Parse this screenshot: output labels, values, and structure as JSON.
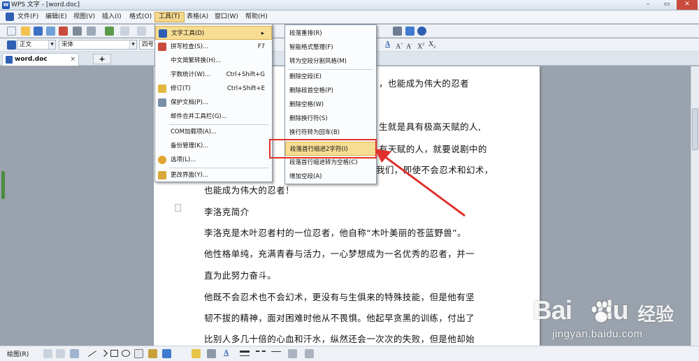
{
  "window": {
    "title": "WPS 文字 - [word.doc]",
    "app_icon_text": "W"
  },
  "menubar": {
    "items": [
      "文件(F)",
      "编辑(E)",
      "视图(V)",
      "插入(I)",
      "格式(O)",
      "工具(T)",
      "表格(A)",
      "窗口(W)",
      "帮助(H)"
    ],
    "active_index": 5
  },
  "formatting": {
    "style_value": "正文",
    "font_value": "宋体",
    "size_value": "四号"
  },
  "tabs": {
    "doc_label": "word.doc",
    "close_glyph": "×",
    "add_glyph": "+"
  },
  "tools_menu": {
    "items": [
      {
        "label": "文字工具(D)",
        "shortcut": "",
        "icon": "text-tool-icon",
        "submenu": true
      },
      {
        "label": "拼写检查(S)...",
        "shortcut": "F7",
        "icon": "spellcheck-icon"
      },
      {
        "label": "中文简繁转换(H)...",
        "shortcut": "",
        "icon": ""
      },
      {
        "label": "字数统计(W)...",
        "shortcut": "Ctrl+Shift+G",
        "icon": ""
      },
      {
        "label": "修订(T)",
        "shortcut": "Ctrl+Shift+E",
        "icon": "revision-icon"
      },
      {
        "label": "保护文档(P)...",
        "shortcut": "",
        "icon": "protect-icon"
      },
      {
        "label": "邮件合并工具栏(G)...",
        "shortcut": "",
        "icon": ""
      },
      {
        "label": "COM加载项(A)...",
        "shortcut": "",
        "icon": ""
      },
      {
        "label": "备份管理(K)...",
        "shortcut": "",
        "icon": ""
      },
      {
        "label": "选项(L)...",
        "shortcut": "",
        "icon": "gear-icon"
      },
      {
        "label": "更改界面(Y)...",
        "shortcut": "",
        "icon": "interface-icon"
      }
    ]
  },
  "text_tools_submenu": {
    "items": [
      "段落重排(R)",
      "智能格式整理(F)",
      "转为空段分割风格(M)",
      "删除空段(E)",
      "删除段首空格(P)",
      "删除空格(W)",
      "删除换行符(S)",
      "换行符转为回车(B)",
      "段落首行缩进2字符(I)",
      "段落首行缩进转为空格(C)",
      "增加空段(A)"
    ],
    "highlight_index": 8
  },
  "document": {
    "lines": [
      "，也能成为伟大的忍者",
      "生就是具有极高天赋的人,",
      "有天赋的人，就要说剧中的",
      "我们，即使不会忍术和幻术，",
      "也能成为伟大的忍者！",
      "李洛克简介",
      "李洛克是木叶忍者村的一位忍者，他自称“木叶美丽的苍蓝野兽”。",
      "他性格单纯，充满青春与活力，一心梦想成为一名优秀的忍者，并一",
      "直为此努力奋斗。",
      "他既不会忍术也不会幻术，更没有与生俱来的特殊技能，但是他有坚",
      "韧不拔的精神，面对困难时他从不畏惧。他起早贪黑的训练，付出了",
      "比别人多几十倍的心血和汗水，纵然还会一次次的失败，但是他却始"
    ]
  },
  "drawbar": {
    "label": "绘图(R)"
  },
  "watermark": {
    "logo": "Bai",
    "logo_suffix": "du",
    "brand_cn": "经验",
    "url": "jingyan.baidu.com"
  },
  "colors": {
    "accent": "#f7dc93",
    "callout": "#e0312c"
  }
}
